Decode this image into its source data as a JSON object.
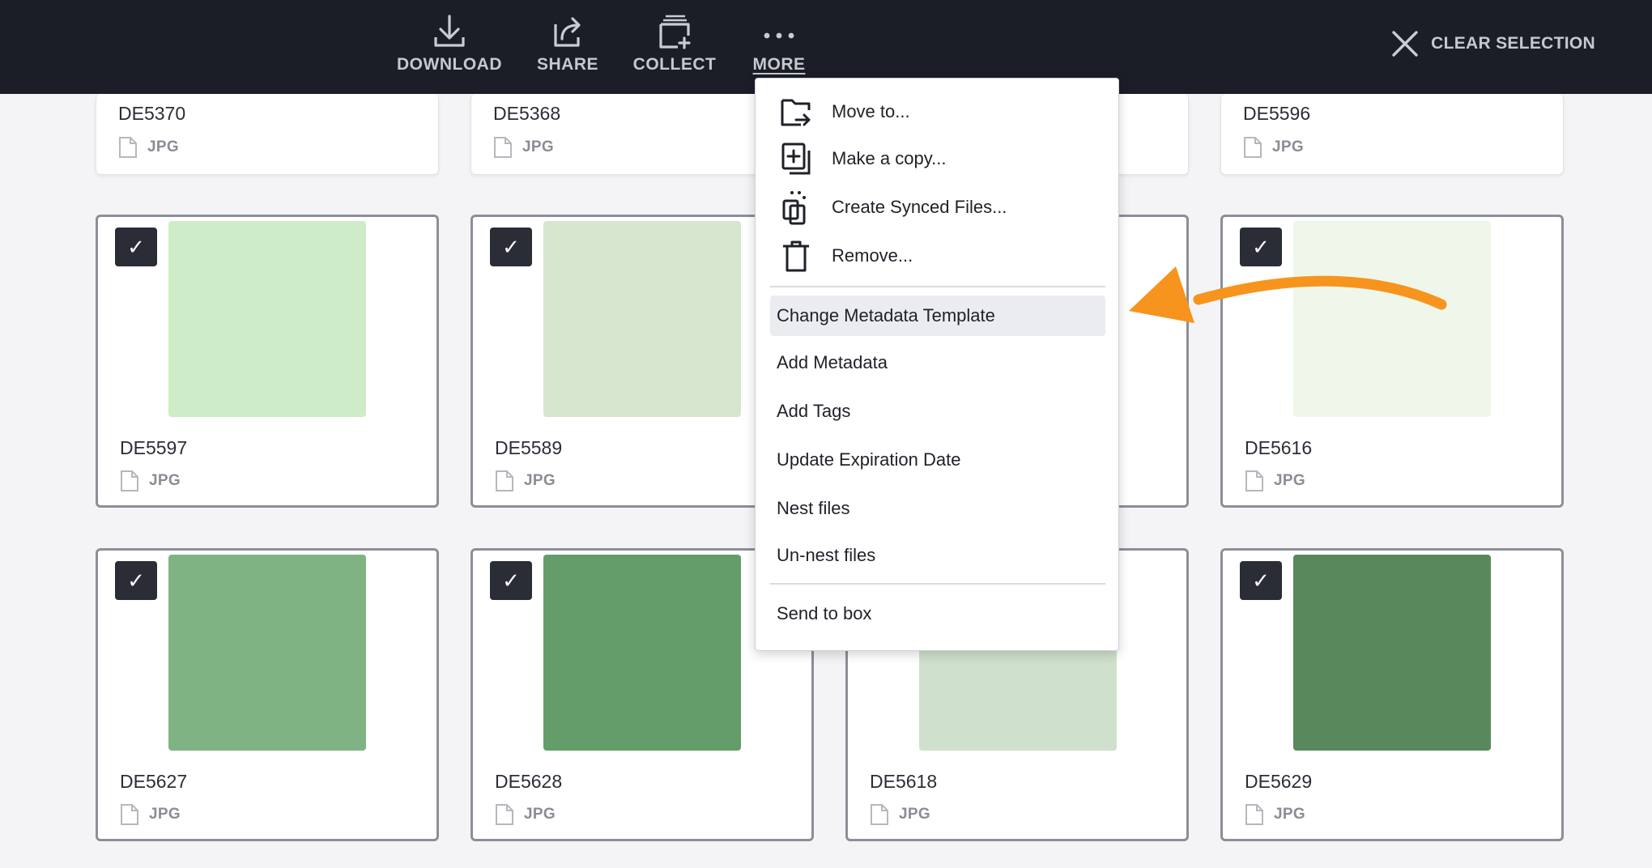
{
  "toolbar": {
    "download_label": "DOWNLOAD",
    "share_label": "SHARE",
    "collect_label": "COLLECT",
    "more_label": "MORE",
    "clear_selection_label": "CLEAR SELECTION",
    "icons": [
      "download-icon",
      "share-icon",
      "collect-icon",
      "more-icon",
      "close-icon"
    ]
  },
  "grid": {
    "top_row": [
      {
        "name": "DE5370",
        "type": "JPG"
      },
      {
        "name": "DE5368",
        "type": "JPG"
      },
      {
        "name": "DE5596",
        "type": "JPG"
      }
    ],
    "selected_cards": [
      {
        "name": "DE5597",
        "type": "JPG",
        "color": "#cdecc7"
      },
      {
        "name": "DE5589",
        "type": "JPG",
        "color": "#d6e6cf"
      },
      {
        "name": "DE5616",
        "type": "JPG",
        "color": "#eef7ea"
      },
      {
        "name": "DE5627",
        "type": "JPG",
        "color": "#7fb384"
      },
      {
        "name": "DE5628",
        "type": "JPG",
        "color": "#659d6a"
      },
      {
        "name": "DE5618",
        "type": "JPG",
        "color": "#cfe1cc"
      },
      {
        "name": "DE5629",
        "type": "JPG",
        "color": "#58885b"
      }
    ],
    "checkbox_glyph": "✓"
  },
  "menu": {
    "move_to": "Move to...",
    "make_copy": "Make a copy...",
    "create_synced": "Create Synced Files...",
    "remove": "Remove...",
    "change_metadata_template": "Change Metadata Template",
    "add_metadata": "Add Metadata",
    "add_tags": "Add Tags",
    "update_expiration": "Update Expiration Date",
    "nest_files": "Nest files",
    "unnest_files": "Un-nest files",
    "send_to_box": "Send to box"
  },
  "colors": {
    "toolbar_bg": "#1b1e27",
    "annotation_arrow": "#f7941d",
    "highlight": "#ebecf0"
  }
}
